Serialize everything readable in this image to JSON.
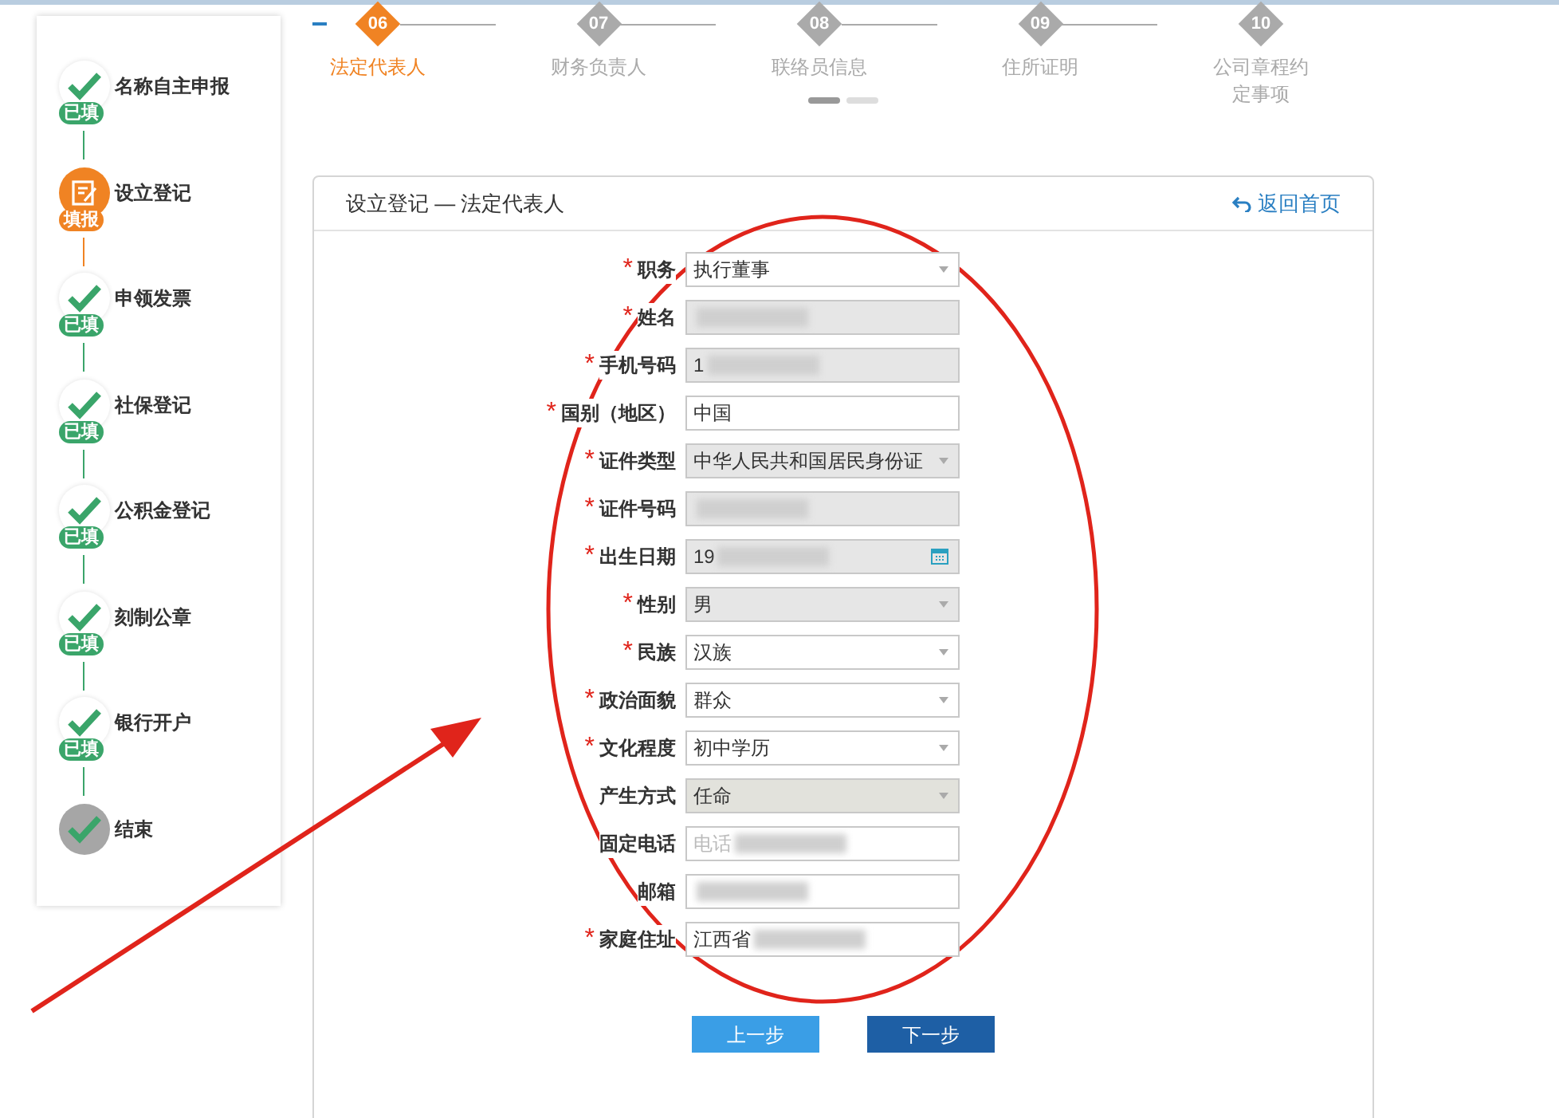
{
  "sidebar": {
    "steps": [
      {
        "label": "名称自主申报",
        "kind": "done",
        "badge": "已填"
      },
      {
        "label": "设立登记",
        "kind": "current",
        "badge": "填报"
      },
      {
        "label": "申领发票",
        "kind": "done",
        "badge": "已填"
      },
      {
        "label": "社保登记",
        "kind": "done",
        "badge": "已填"
      },
      {
        "label": "公积金登记",
        "kind": "done",
        "badge": "已填"
      },
      {
        "label": "刻制公章",
        "kind": "done",
        "badge": "已填"
      },
      {
        "label": "银行开户",
        "kind": "done",
        "badge": "已填"
      },
      {
        "label": "结束",
        "kind": "end"
      }
    ]
  },
  "stepper": {
    "steps": [
      {
        "number": "06",
        "label": "法定代表人",
        "selected": true
      },
      {
        "number": "07",
        "label": "财务负责人",
        "selected": false
      },
      {
        "number": "08",
        "label": "联络员信息",
        "selected": false
      },
      {
        "number": "09",
        "label": "住所证明",
        "selected": false
      },
      {
        "number": "10",
        "label": "公司章程约定事项",
        "selected": false
      }
    ],
    "pages": [
      {
        "selected": true
      },
      {
        "selected": false
      }
    ]
  },
  "panel": {
    "title": "设立登记 — 法定代表人",
    "back_link": "返回首页",
    "fields": [
      {
        "required_mark": "*",
        "label": "职务",
        "kind": "select",
        "value": "执行董事",
        "readonly": false,
        "disabled": false,
        "blurred": false
      },
      {
        "required_mark": "*",
        "label": "姓名",
        "kind": "text",
        "readonly": true,
        "disabled": false,
        "blurred": true
      },
      {
        "required_mark": "*",
        "label": "手机号码",
        "kind": "text",
        "value": "1",
        "readonly": true,
        "disabled": false,
        "blurred": true
      },
      {
        "required_mark": "*",
        "label": "国别（地区）",
        "kind": "text",
        "value": "中国",
        "readonly": false,
        "disabled": false,
        "blurred": false
      },
      {
        "required_mark": "*",
        "label": "证件类型",
        "kind": "select",
        "value": "中华人民共和国居民身份证",
        "readonly": true,
        "disabled": false,
        "blurred": false
      },
      {
        "required_mark": "*",
        "label": "证件号码",
        "kind": "text",
        "readonly": true,
        "disabled": false,
        "blurred": true
      },
      {
        "required_mark": "*",
        "label": "出生日期",
        "kind": "date",
        "value": "19",
        "readonly": true,
        "disabled": false,
        "blurred": true
      },
      {
        "required_mark": "*",
        "label": "性别",
        "kind": "select",
        "value": "男",
        "readonly": true,
        "disabled": false,
        "blurred": false
      },
      {
        "required_mark": "*",
        "label": "民族",
        "kind": "select",
        "value": "汉族",
        "readonly": false,
        "disabled": false,
        "blurred": false
      },
      {
        "required_mark": "*",
        "label": "政治面貌",
        "kind": "select",
        "value": "群众",
        "readonly": false,
        "disabled": false,
        "blurred": false
      },
      {
        "required_mark": "*",
        "label": "文化程度",
        "kind": "select",
        "value": "初中学历",
        "readonly": false,
        "disabled": false,
        "blurred": false
      },
      {
        "label": "产生方式",
        "kind": "select",
        "value": "任命",
        "disabled": true,
        "blurred": false
      },
      {
        "label": "固定电话",
        "kind": "text",
        "placeholder": "电话",
        "readonly": false,
        "disabled": false,
        "blurred": true
      },
      {
        "label": "邮箱",
        "kind": "text",
        "readonly": false,
        "disabled": false,
        "blurred": true
      },
      {
        "required_mark": "*",
        "label": "家庭住址",
        "kind": "text",
        "value": "江西省",
        "readonly": false,
        "disabled": false,
        "blurred": true
      }
    ],
    "buttons": [
      {
        "label": "上一步",
        "kind": "secondary"
      },
      {
        "label": "下一步",
        "kind": "primary"
      }
    ]
  }
}
